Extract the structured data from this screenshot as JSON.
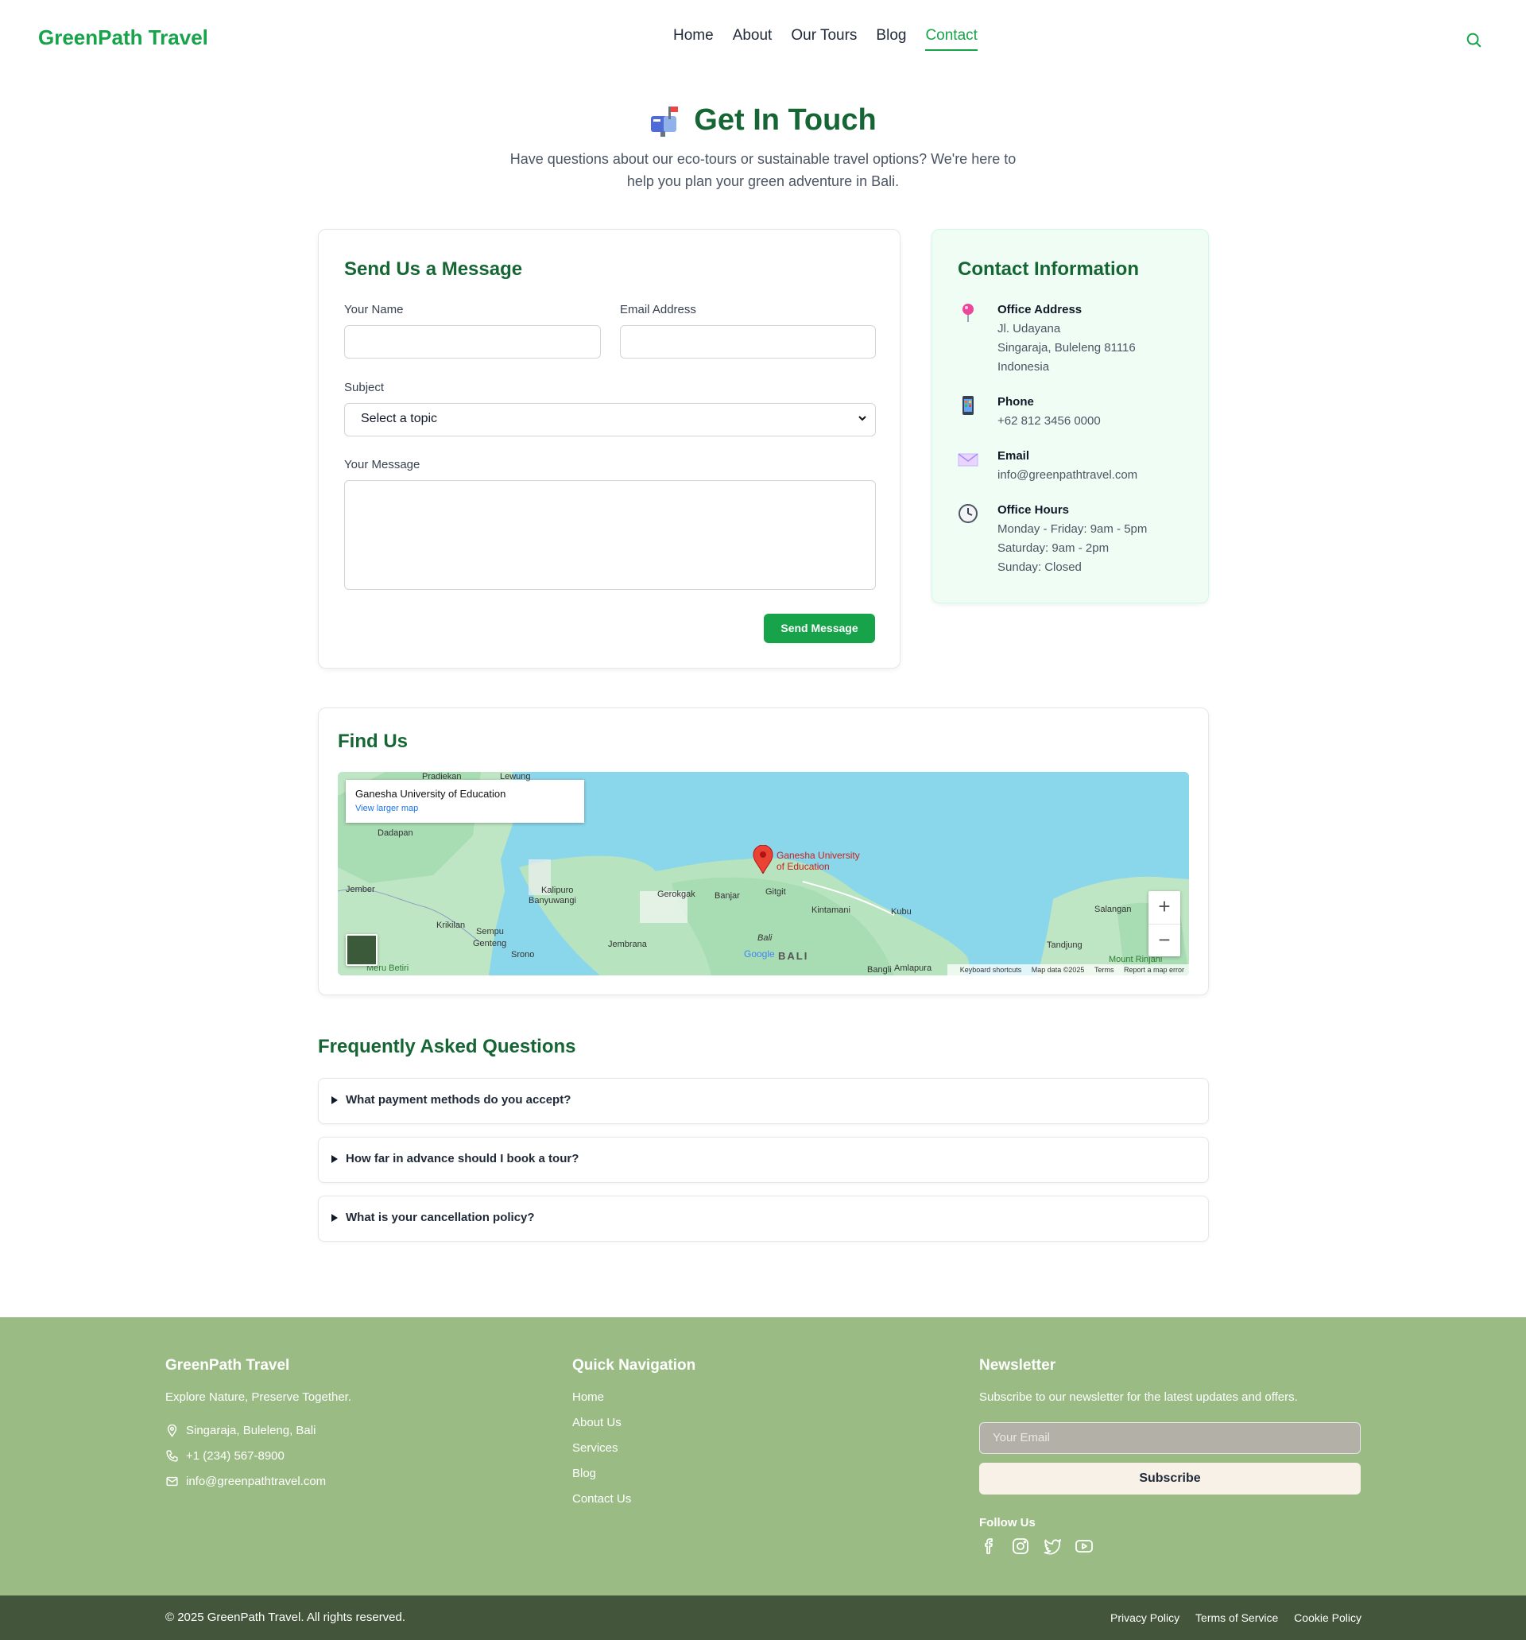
{
  "brand": "GreenPath Travel",
  "nav": {
    "home": "Home",
    "about": "About",
    "tours": "Our Tours",
    "blog": "Blog",
    "contact": "Contact",
    "active": "contact"
  },
  "hero": {
    "title": "Get In Touch",
    "subtitle": "Have questions about our eco-tours or sustainable travel options? We're here to help you plan your green adventure in Bali."
  },
  "form": {
    "title": "Send Us a Message",
    "name_label": "Your Name",
    "name_value": "",
    "email_label": "Email Address",
    "email_value": "",
    "subject_label": "Subject",
    "subject_value": "Select a topic",
    "message_label": "Your Message",
    "message_value": "",
    "submit": "Send Message"
  },
  "contact_info": {
    "title": "Contact Information",
    "address_head": "Office Address",
    "address_lines": [
      "Jl. Udayana",
      "Singaraja, Buleleng 81116",
      "Indonesia"
    ],
    "phone_head": "Phone",
    "phone": "+62 812 3456 0000",
    "email_head": "Email",
    "email": "info@greenpathtravel.com",
    "hours_head": "Office Hours",
    "hours_lines": [
      "Monday - Friday: 9am - 5pm",
      "Saturday: 9am - 2pm",
      "Sunday: Closed"
    ]
  },
  "map": {
    "title": "Find Us",
    "popup_title": "Ganesha University of Education",
    "popup_link": "View larger map",
    "marker_label_1": "Ganesha University",
    "marker_label_2": "of Education",
    "places": {
      "pradiekan": "Pradiekan",
      "lewung": "Lewung",
      "dadapan": "Dadapan",
      "jember": "Jember",
      "kalipuro": "Kalipuro",
      "banyuwangi": "Banyuwangi",
      "gerokgak": "Gerokgak",
      "banjar": "Banjar",
      "gitgit": "Gitgit",
      "kintamani": "Kintamani",
      "kubu": "Kubu",
      "salangan": "Salangan",
      "krikilan": "Krikilan",
      "sempu": "Sempu",
      "genteng": "Genteng",
      "srono": "Srono",
      "jembrana": "Jembrana",
      "bali_small": "Bali",
      "bali": "BALI",
      "amlapura": "Amlapura",
      "bangli": "Bangli",
      "tandjung": "Tandjung",
      "meru_betiri": "Meru Betiri",
      "mount_rinjani": "Mount Rinjani"
    },
    "google": "Google",
    "footer_shortcuts": "Keyboard shortcuts",
    "footer_data": "Map data ©2025",
    "footer_terms": "Terms",
    "footer_report": "Report a map error",
    "zoom_in": "+",
    "zoom_out": "−"
  },
  "faq": {
    "title": "Frequently Asked Questions",
    "items": [
      "What payment methods do you accept?",
      "How far in advance should I book a tour?",
      "What is your cancellation policy?"
    ]
  },
  "footer": {
    "brand": "GreenPath Travel",
    "tagline": "Explore Nature, Preserve Together.",
    "location": "Singaraja, Buleleng, Bali",
    "phone": "+1 (234) 567-8900",
    "email": "info@greenpathtravel.com",
    "nav_title": "Quick Navigation",
    "nav_items": [
      "Home",
      "About Us",
      "Services",
      "Blog",
      "Contact Us"
    ],
    "newsletter_title": "Newsletter",
    "newsletter_text": "Subscribe to our newsletter for the latest updates and offers.",
    "email_placeholder": "Your Email",
    "subscribe": "Subscribe",
    "follow": "Follow Us",
    "social_icons": [
      "facebook-icon",
      "instagram-icon",
      "twitter-icon",
      "youtube-icon"
    ]
  },
  "bottom": {
    "copyright": "© 2025 GreenPath Travel. All rights reserved.",
    "privacy": "Privacy Policy",
    "terms": "Terms of Service",
    "cookie": "Cookie Policy"
  },
  "colors": {
    "brand_green": "#16a34a",
    "heading_green": "#166534",
    "footer_bg": "#9abc84",
    "bottom_bg": "#43553a",
    "info_bg": "#f0fdf4"
  }
}
